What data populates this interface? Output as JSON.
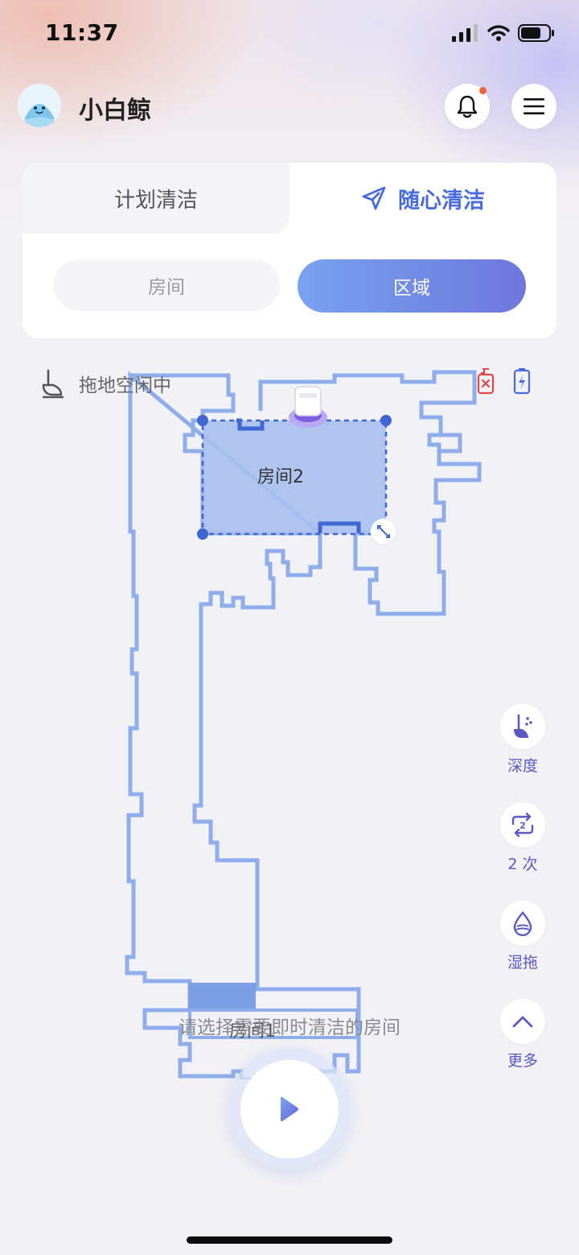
{
  "status_bar": {
    "time": "11:37"
  },
  "header": {
    "title": "小白鲸"
  },
  "mode_tabs": {
    "scheduled": "计划清洁",
    "instant": "随心清洁"
  },
  "segments": {
    "room": "房间",
    "zone": "区域"
  },
  "status": {
    "mop_text": "拖地空闲中"
  },
  "map": {
    "room2_label": "房间2",
    "room1_label": "房间1",
    "hint": "请选择需要即时清洁的房间"
  },
  "side_controls": [
    {
      "label": "深度",
      "icon": "suction-depth-icon"
    },
    {
      "label": "2 次",
      "icon": "repeat-2-icon"
    },
    {
      "label": "湿拖",
      "icon": "water-drop-icon"
    },
    {
      "label": "更多",
      "icon": "chevron-up-icon"
    }
  ],
  "colors": {
    "accent": "#4a6be0",
    "accent_purple": "#5b58c4",
    "map_wall": "#8fadea",
    "zone_fill": "#a8bff0",
    "zone_border": "#3e67d4",
    "warning": "#e04848"
  }
}
